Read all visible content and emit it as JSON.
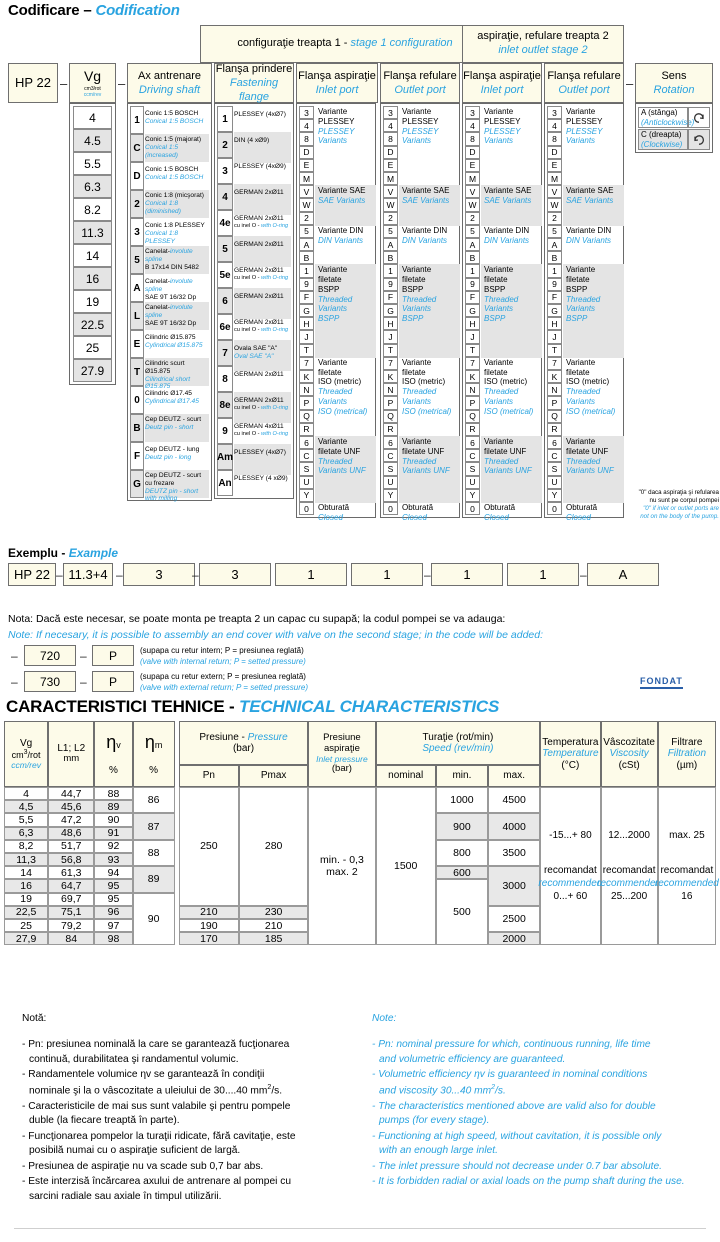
{
  "codification": {
    "title_ro": "Codificare",
    "title_sep": "–",
    "title_en": "Codification",
    "bands": {
      "stage1_ro": "configuraţie treapta 1 -",
      "stage1_en": "stage 1 configuration",
      "stage2_ro": "aspiraţie, refulare treapta 2",
      "stage2_en": "inlet outlet stage 2"
    },
    "columns": [
      {
        "ro": "HP 22",
        "en": ""
      },
      {
        "ro": "Vg",
        "en": "cm3/rot",
        "en2": "ccm/rev"
      },
      {
        "ro": "Ax antrenare",
        "en": "Driving shaft"
      },
      {
        "ro": "Flanşa prindere",
        "en": "Fastening flange"
      },
      {
        "ro": "Flanşa aspiraţie",
        "en": "Inlet port"
      },
      {
        "ro": "Flanşa refulare",
        "en": "Outlet port"
      },
      {
        "ro": "Flanşa aspiraţie",
        "en": "Inlet port"
      },
      {
        "ro": "Flanşa refulare",
        "en": "Outlet port"
      },
      {
        "ro": "Sens",
        "en": "Rotation"
      }
    ],
    "displacements": [
      "4",
      "4.5",
      "5.5",
      "6.3",
      "8.2",
      "11.3",
      "14",
      "16",
      "19",
      "22.5",
      "25",
      "27.9"
    ],
    "shafts": [
      {
        "code": "1",
        "ro": "Conic 1:5   BOSCH",
        "en": "Conical 1:5 BOSCH"
      },
      {
        "code": "C",
        "ro": "Conic 1:5  (majorat)",
        "en": "Conical 1:5 (increased)"
      },
      {
        "code": "D",
        "ro": "Conic 1:5   BOSCH",
        "en": "Conical 1:5 BOSCH"
      },
      {
        "code": "2",
        "ro": "Conic 1:8  (micşorat)",
        "en": "Conical 1:8 (diminished)"
      },
      {
        "code": "3",
        "ro": "Conic 1:8  PLESSEY",
        "en": "Conical 1:8 PLESSEY"
      },
      {
        "code": "5",
        "ro": "Canelat-",
        "en": "involute spline",
        "ro2": "B 17x14   DIN 5482"
      },
      {
        "code": "A",
        "ro": "Canelat-",
        "en": "involute spline",
        "ro2": "SAE  9T 16/32 Dp"
      },
      {
        "code": "L",
        "ro": "Canelat-",
        "en": "involute spline",
        "ro2": "SAE  9T 16/32 Dp"
      },
      {
        "code": "E",
        "ro": "Cilindric     Ø15.875",
        "en": "Cylindrical  Ø15.875"
      },
      {
        "code": "T",
        "ro": "Cilindric scurt Ø15.875",
        "en": "Cilindrical short Ø15.875"
      },
      {
        "code": "0",
        "ro": "Cilindric    Ø17.45",
        "en": "Cylindrical  Ø17.45"
      },
      {
        "code": "B",
        "ro": "Cep DEUTZ - scurt",
        "en": "Deutz pin - short"
      },
      {
        "code": "F",
        "ro": "Cep DEUTZ - lung",
        "en": "Deutz pin - long"
      },
      {
        "code": "G",
        "ro": "Cep DEUTZ - scurt cu frezare",
        "en": "DEUTZ pin - short with milling"
      }
    ],
    "flanges": [
      {
        "code": "1",
        "ro": "PLESSEY (4xØ7)",
        "en": ""
      },
      {
        "code": "2",
        "ro": "DIN   (4 xØ9)",
        "en": ""
      },
      {
        "code": "3",
        "ro": "PLESSEY (4xØ9)",
        "en": ""
      },
      {
        "code": "4",
        "ro": "GERMAN  2xØ11",
        "en": ""
      },
      {
        "code": "4e",
        "ro": "GERMAN  2xØ11",
        "ro2": "cu inel O -",
        "en": "with O-ring"
      },
      {
        "code": "5",
        "ro": "GERMAN  2xØ11",
        "en": ""
      },
      {
        "code": "5e",
        "ro": "GERMAN  2xØ11",
        "ro2": "cu inel O -",
        "en": "with O-ring"
      },
      {
        "code": "6",
        "ro": "GERMAN  2xØ11",
        "en": ""
      },
      {
        "code": "6e",
        "ro": "GERMAN  2xØ11",
        "ro2": "cu inel O -",
        "en": "with O-ring"
      },
      {
        "code": "7",
        "ro": "Ovala SAE \"A\"",
        "en": "Oval  SAE \"A\""
      },
      {
        "code": "8",
        "ro": "GERMAN  2xØ11",
        "en": ""
      },
      {
        "code": "8e",
        "ro": "GERMAN  2xØ11",
        "ro2": "cu inel O -",
        "en": "with O-ring"
      },
      {
        "code": "9",
        "ro": "GERMAN  4xØ11",
        "ro2": "cu inel O -",
        "en": "with O-ring"
      },
      {
        "code": "Am",
        "ro": "PLESSEY (4xØ7)",
        "en": ""
      },
      {
        "code": "An",
        "ro": "PLESSEY (4 xØ9)",
        "en": ""
      }
    ],
    "port_codes": [
      "3",
      "4",
      "8",
      "D",
      "E",
      "M",
      "V",
      "W",
      "2",
      "5",
      "A",
      "B",
      "1",
      "9",
      "F",
      "G",
      "H",
      "J",
      "T",
      "7",
      "K",
      "N",
      "P",
      "Q",
      "R",
      "6",
      "C",
      "S",
      "U",
      "Y",
      "0"
    ],
    "port_groups": [
      {
        "ro1": "Variante",
        "ro2": "PLESSEY",
        "en1": "PLESSEY",
        "en2": "Variants",
        "span": 6,
        "shade": false
      },
      {
        "ro1": "Variante SAE",
        "ro2": "",
        "en1": "SAE Variants",
        "en2": "",
        "span": 3,
        "shade": true
      },
      {
        "ro1": "Variante DIN",
        "ro2": "",
        "en1": "DIN Variants",
        "en2": "",
        "span": 3,
        "shade": false
      },
      {
        "ro1": "Variante",
        "ro2": "filetate",
        "ro3": "BSPP",
        "en1": "Threaded",
        "en2": "Variants",
        "en3": "BSPP",
        "span": 7,
        "shade": true
      },
      {
        "ro1": "Variante",
        "ro2": "filetate",
        "ro3": "ISO (metric)",
        "en1": "Threaded",
        "en2": "Variants",
        "en3": "ISO (metrical)",
        "span": 6,
        "shade": false
      },
      {
        "ro1": "Variante",
        "ro2": "filetate UNF",
        "en1": "Threaded",
        "en2": "Variants UNF",
        "span": 5,
        "shade": true
      },
      {
        "ro1": "Obturată",
        "en1": "Closed",
        "span": 1,
        "shade": false
      }
    ],
    "rotation": [
      {
        "code_ro": "A (stânga)",
        "code_en": "(Anticlockwise)",
        "icon": "rotate-ccw-icon"
      },
      {
        "code_ro": "C (dreapta)",
        "code_en": "(Clockwise)",
        "icon": "rotate-cw-icon"
      }
    ],
    "footnote": {
      "ro1": "\"0\" daca aspiraţia şi refularea",
      "ro2": "nu sunt pe corpul pompei",
      "en1": "\"0\" if inlet or outlet ports are",
      "en2": "not on the body of the pump."
    }
  },
  "example": {
    "label_ro": "Exemplu -",
    "label_en": "Example",
    "cells": [
      "HP 22",
      "11.3+4",
      "3",
      "3",
      "1",
      "1",
      "1",
      "1",
      "A"
    ],
    "note_ro": "Nota: Dacă este necesar, se poate monta pe treapta 2 un capac cu supapă; la codul pompei se va adauga:",
    "note_en": "Note:  If necesary, it is possible to assembly an end cover with valve on the second stage; in the code will be added:",
    "valves": [
      {
        "code": "720",
        "letter": "P",
        "ro": "(supapa cu retur intern; P = presiunea reglată)",
        "en": "(valve with internal return; P = setted pressure)"
      },
      {
        "code": "730",
        "letter": "P",
        "ro": "(supapa cu retur extern; P = presiunea reglată)",
        "en": "(valve with external return; P = setted pressure)"
      }
    ],
    "logo": "FONDAT"
  },
  "characteristics": {
    "title_ro": "CARACTERISTICI TEHNICE -",
    "title_en": "TECHNICAL CHARACTERISTICS",
    "headers": {
      "vg_ro": "Vg",
      "vg_unit": "cm3/rot",
      "vg_en": "ccm/rev",
      "l_ro": "L1; L2",
      "l_unit": "mm",
      "nv": "η",
      "nv_sub": "v",
      "nm": "η",
      "nm_sub": "m",
      "pct": "%",
      "pressure_ro": "Presiune -",
      "pressure_en": "Pressure",
      "pressure_unit": "(bar)",
      "pn": "Pn",
      "pmax": "Pmax",
      "inlet_ro1": "Presiune",
      "inlet_ro2": "aspiraţie",
      "inlet_en": "Inlet pressure",
      "inlet_unit": "(bar)",
      "speed_ro": "Turaţie (rot/min)",
      "speed_en": "Speed (rev/min)",
      "nominal": "nominal",
      "min": "min.",
      "max": "max.",
      "temp_ro": "Temperatura",
      "temp_en": "Temperature",
      "temp_unit": "(°C)",
      "visc_ro": "Vâscozitate",
      "visc_en": "Viscosity",
      "visc_unit": "(cSt)",
      "filt_ro": "Filtrare",
      "filt_en": "Filtration",
      "filt_unit": "(µm)"
    },
    "rows": [
      {
        "vg": "4",
        "l": "44,7",
        "nv": "88"
      },
      {
        "vg": "4,5",
        "l": "45,6",
        "nv": "89"
      },
      {
        "vg": "5,5",
        "l": "47,2",
        "nv": "90"
      },
      {
        "vg": "6,3",
        "l": "48,6",
        "nv": "91"
      },
      {
        "vg": "8,2",
        "l": "51,7",
        "nv": "92"
      },
      {
        "vg": "11,3",
        "l": "56,8",
        "nv": "93"
      },
      {
        "vg": "14",
        "l": "61,3",
        "nv": "94"
      },
      {
        "vg": "16",
        "l": "64,7",
        "nv": "95"
      },
      {
        "vg": "19",
        "l": "69,7",
        "nv": "95"
      },
      {
        "vg": "22,5",
        "l": "75,1",
        "nv": "96"
      },
      {
        "vg": "25",
        "l": "79,2",
        "nv": "97"
      },
      {
        "vg": "27,9",
        "l": "84",
        "nv": "98"
      }
    ],
    "nm_groups": [
      {
        "value": "86",
        "span": 2
      },
      {
        "value": "87",
        "span": 2
      },
      {
        "value": "88",
        "span": 2
      },
      {
        "value": "89",
        "span": 2
      },
      {
        "value": "90",
        "span": 4
      }
    ],
    "pressure": {
      "pn_main": "250",
      "pmax_main": "280",
      "main_span": 9,
      "tail": [
        {
          "pn": "210",
          "pmax": "230"
        },
        {
          "pn": "190",
          "pmax": "210"
        },
        {
          "pn": "170",
          "pmax": "185"
        }
      ]
    },
    "inlet_pressure": {
      "line1": "min. - 0,3",
      "line2": "max. 2"
    },
    "speed": {
      "nominal": "1500",
      "min": [
        {
          "v": "1000",
          "span": 2
        },
        {
          "v": "900",
          "span": 2
        },
        {
          "v": "800",
          "span": 2
        },
        {
          "v": "600",
          "span": 1
        },
        {
          "v": "500",
          "span": 5
        }
      ],
      "max": [
        {
          "v": "4500",
          "span": 2
        },
        {
          "v": "4000",
          "span": 2
        },
        {
          "v": "3500",
          "span": 2
        },
        {
          "v": "3000",
          "span": 3
        },
        {
          "v": "2500",
          "span": 2
        },
        {
          "v": "2000",
          "span": 1
        }
      ]
    },
    "temperature": {
      "range": "-15...+ 80",
      "rec_ro": "recomandat",
      "rec_en": "recommended",
      "rec_val": "0...+ 60"
    },
    "viscosity": {
      "range": "12...2000",
      "rec_ro": "recomandat",
      "rec_en": "recommended",
      "rec_val": "25...200"
    },
    "filtration": {
      "range": "max. 25",
      "rec_ro": "recomandat",
      "rec_en": "recommended",
      "rec_val": "16"
    }
  },
  "notes": {
    "ro_title": "Notă:",
    "ro_items": [
      "- Pn: presiunea nominală la care se garantează fucţionarea\n    continuă, durabilitatea şi randamentul volumic.",
      "- Randamentele volumice ηv se garantează în condiţii\n    nominale şi la o vâscozitate a uleiului de 30....40 mm2/s.",
      "- Caracteristicile de mai sus sunt valabile şi pentru pompele\n    duble (la fiecare treaptă în parte).",
      "- Funcţionarea pompelor la turaţii ridicate, fără cavitaţie, este\n    posibilă numai cu o aspiraţie suficient de largă.",
      "- Presiunea de aspiraţie nu va scade sub 0,7 bar abs.",
      "- Este interzisă încărcarea axului de antrenare al pompei cu\n  sarcini radiale sau axiale în timpul utilizării."
    ],
    "en_title": "Note:",
    "en_items": [
      "- Pn: nominal pressure for which, continuous running, life time\n    and volumetric efficiency are guaranteed.",
      "- Volumetric efficiency ηv is guaranteed in nominal conditions\n    and viscosity 30...40 mm2/s.",
      "- The characteristics mentioned above are valid also for double\n    pumps (for every stage).",
      "- Functioning at high speed, without cavitation, it is possible only\n    with an enough large inlet.",
      "- The inlet pressure should not decrease under 0.7 bar absolute.",
      "- It is forbidden radial or axial loads on the pump shaft during the use."
    ]
  }
}
